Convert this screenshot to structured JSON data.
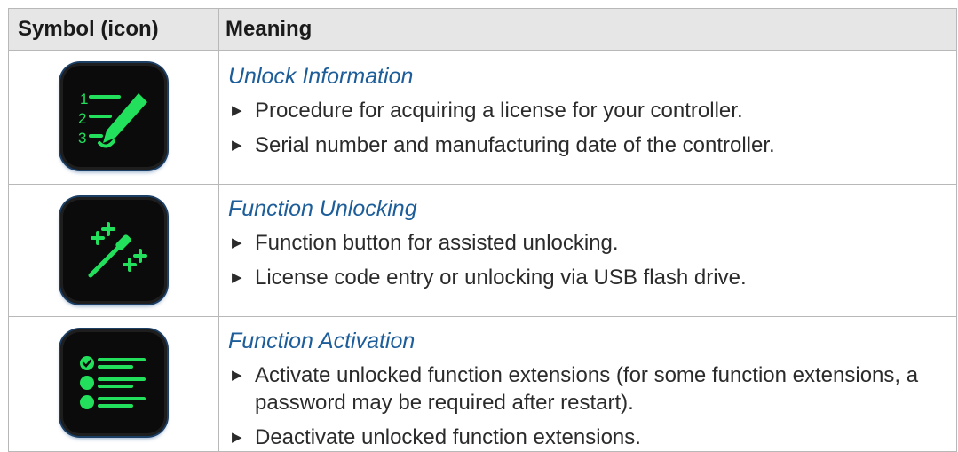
{
  "header": {
    "col1": "Symbol (icon)",
    "col2": "Meaning"
  },
  "rows": [
    {
      "icon": "numbered-list-pencil-icon",
      "title": "Unlock Information",
      "items": [
        "Procedure for acquiring a license for your controller.",
        "Serial number and manufacturing date of the controller."
      ]
    },
    {
      "icon": "magic-wand-plus-icon",
      "title": "Function Unlocking",
      "items": [
        "Function button for assisted unlocking.",
        "License code entry or unlocking via USB flash drive."
      ]
    },
    {
      "icon": "checklist-icon",
      "title": "Function Activation",
      "items": [
        "Activate unlocked function extensions (for some function extensions, a password may be required after restart).",
        "Deactivate unlocked function extensions."
      ]
    }
  ],
  "colors": {
    "icon_green": "#22e05c",
    "title_blue": "#1d5e9a",
    "header_bg": "#e6e6e6"
  },
  "bullet_glyph": "▶"
}
